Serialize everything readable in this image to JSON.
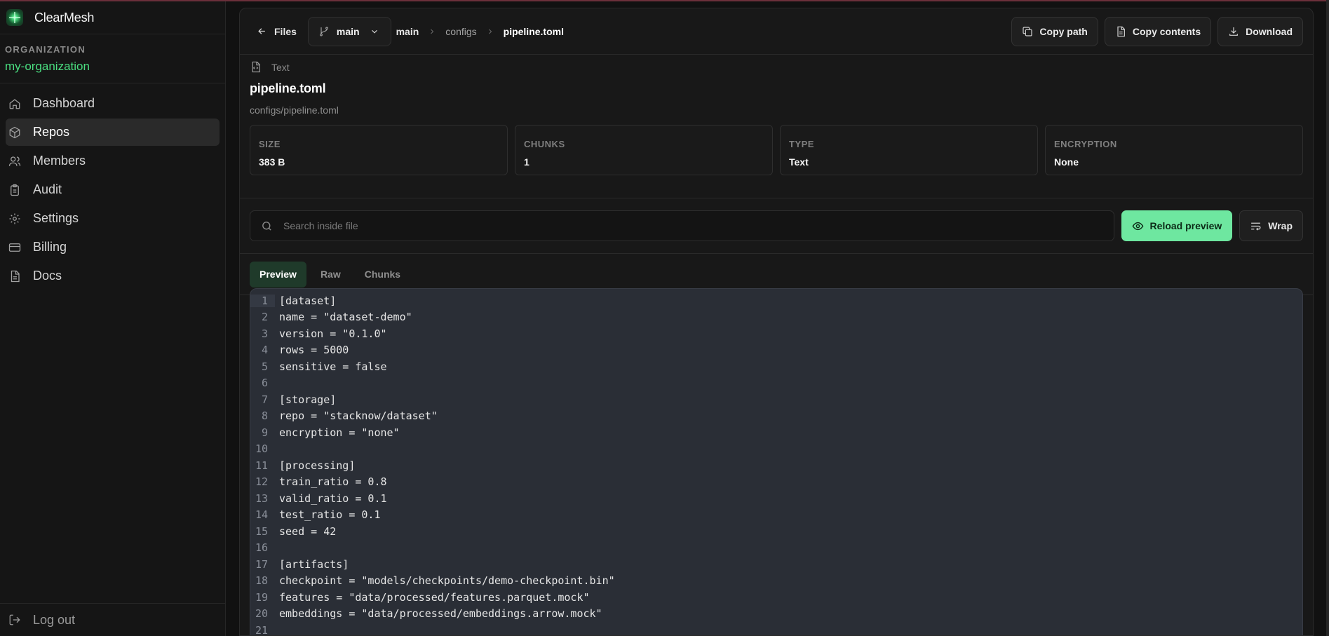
{
  "brand": {
    "name": "ClearMesh"
  },
  "org": {
    "label": "ORGANIZATION",
    "name": "my-organization"
  },
  "nav": {
    "items": [
      {
        "label": "Dashboard",
        "icon": "home-icon"
      },
      {
        "label": "Repos",
        "icon": "box-icon",
        "active": true
      },
      {
        "label": "Members",
        "icon": "users-icon"
      },
      {
        "label": "Audit",
        "icon": "clipboard-icon"
      },
      {
        "label": "Settings",
        "icon": "gear-icon"
      },
      {
        "label": "Billing",
        "icon": "credit-card-icon"
      },
      {
        "label": "Docs",
        "icon": "document-icon"
      }
    ],
    "logout": "Log out"
  },
  "toolbar": {
    "files": "Files",
    "branch": "main",
    "crumbs": [
      "main",
      "configs",
      "pipeline.toml"
    ],
    "copy_path": "Copy path",
    "copy_contents": "Copy contents",
    "download": "Download"
  },
  "file": {
    "type": "Text",
    "name": "pipeline.toml",
    "path": "configs/pipeline.toml",
    "stats": [
      {
        "label": "SIZE",
        "value": "383 B"
      },
      {
        "label": "CHUNKS",
        "value": "1"
      },
      {
        "label": "TYPE",
        "value": "Text"
      },
      {
        "label": "ENCRYPTION",
        "value": "None"
      }
    ]
  },
  "search": {
    "placeholder": "Search inside file",
    "value": ""
  },
  "buttons": {
    "reload": "Reload preview",
    "wrap": "Wrap"
  },
  "tabs": [
    {
      "label": "Preview",
      "active": true
    },
    {
      "label": "Raw"
    },
    {
      "label": "Chunks"
    }
  ],
  "code": {
    "line_numbers": [
      "1",
      "2",
      "3",
      "4",
      "5",
      "6",
      "7",
      "8",
      "9",
      "10",
      "11",
      "12",
      "13",
      "14",
      "15",
      "16",
      "17",
      "18",
      "19",
      "20",
      "21"
    ],
    "lines": [
      "[dataset]",
      "name = \"dataset-demo\"",
      "version = \"0.1.0\"",
      "rows = 5000",
      "sensitive = false",
      "",
      "[storage]",
      "repo = \"stacknow/dataset\"",
      "encryption = \"none\"",
      "",
      "[processing]",
      "train_ratio = 0.8",
      "valid_ratio = 0.1",
      "test_ratio = 0.1",
      "seed = 42",
      "",
      "[artifacts]",
      "checkpoint = \"models/checkpoints/demo-checkpoint.bin\"",
      "features = \"data/processed/features.parquet.mock\"",
      "embeddings = \"data/processed/embeddings.arrow.mock\"",
      ""
    ]
  },
  "colors": {
    "accent": "#4ade80",
    "button_green": "#6ee7a0",
    "code_bg": "#2a2e36"
  }
}
